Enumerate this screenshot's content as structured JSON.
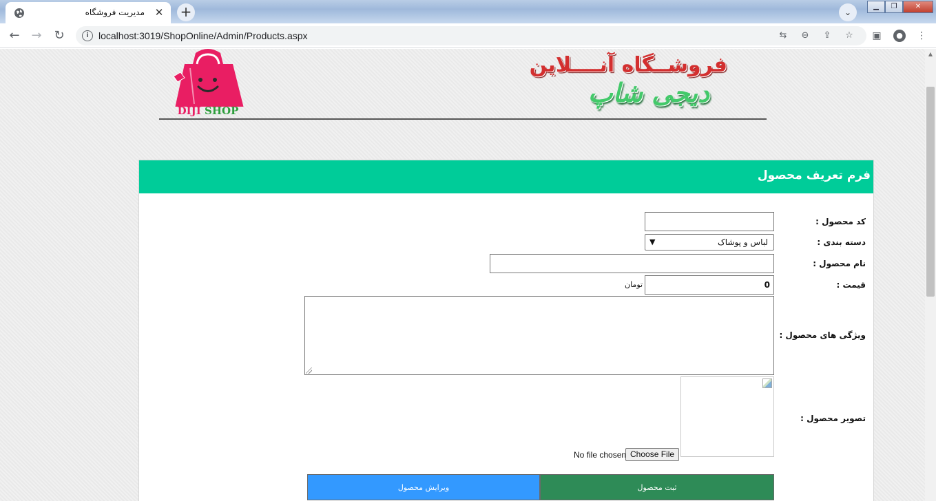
{
  "browser": {
    "tab_title": "مدیریت فروشگاه",
    "tab_close": "✕",
    "new_tab": "+",
    "url": "localhost:3019/ShopOnline/Admin/Products.aspx"
  },
  "header": {
    "logo_text_diji": "DIJI",
    "logo_text_shop": "SHOP",
    "banner_line1": "فروشــگاه آنــــلاین",
    "banner_line2": "دیجی شاپ"
  },
  "form": {
    "title": "فرم تعریف محصول",
    "fields": {
      "code_label": "کد محصول :",
      "code_value": "",
      "category_label": "دسته بندی :",
      "category_selected": "لباس و پوشاک",
      "name_label": "نام محصول :",
      "name_value": "",
      "price_label": "قیمت :",
      "price_value": "0",
      "price_unit": "تومان",
      "features_label": "ویژگی های محصول :",
      "image_label": "تصویر محصول :",
      "no_file": "No file chosen",
      "choose_file": "Choose File"
    },
    "buttons": {
      "save": "ثبت محصول",
      "edit": "ویرایش محصول"
    }
  },
  "colors": {
    "panel_header": "#00cc99",
    "save_button": "#2e8b57",
    "edit_button": "#3399ff",
    "logo_pink": "#e91e63",
    "logo_green": "#2e9e3c"
  }
}
